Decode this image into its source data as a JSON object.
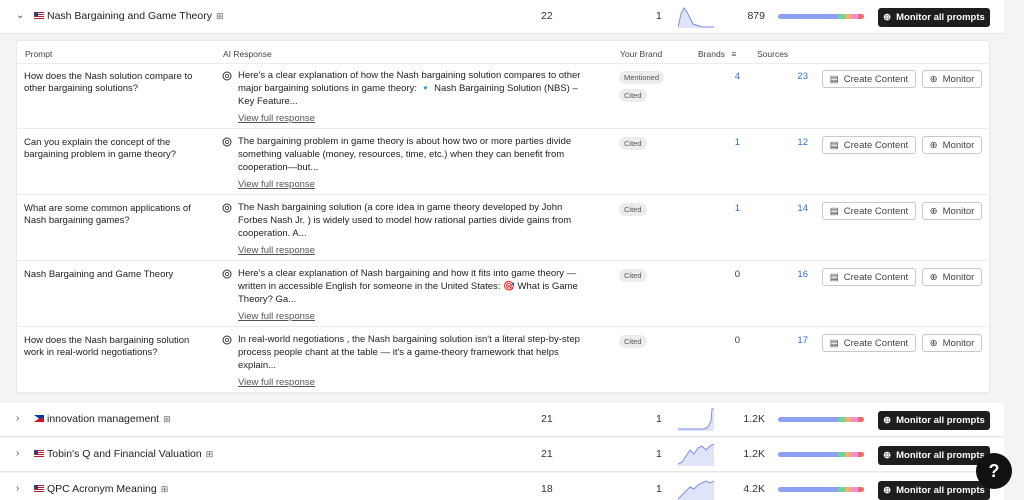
{
  "expanded_topic": {
    "name": "Nash Bargaining and Game Theory",
    "prompts_count": "22",
    "mentions": "1",
    "visibility": "879",
    "monitor_label": "Monitor all prompts"
  },
  "table": {
    "headers": {
      "prompt": "Prompt",
      "ai_response": "AI Response",
      "your_brand": "Your Brand",
      "brands": "Brands",
      "sources": "Sources"
    },
    "rows": [
      {
        "prompt": "How does the Nash solution compare to other bargaining solutions?",
        "response": "Here's a clear explanation of how the Nash bargaining solution compares to other major bargaining solutions in game theory: 🔹 Nash Bargaining Solution (NBS) – Key Feature...",
        "badges": [
          "Mentioned",
          "Cited"
        ],
        "brands": "4",
        "sources": "23"
      },
      {
        "prompt": "Can you explain the concept of the bargaining problem in game theory?",
        "response": "The bargaining problem in game theory is about how two or more parties divide something valuable (money, resources, time, etc.) when they can benefit from cooperation—but...",
        "badges": [
          "Cited"
        ],
        "brands": "1",
        "sources": "12"
      },
      {
        "prompt": "What are some common applications of Nash bargaining games?",
        "response": "The Nash bargaining solution (a core idea in game theory developed by John Forbes Nash Jr. ) is widely used to model how rational parties divide gains from cooperation. A...",
        "badges": [
          "Cited"
        ],
        "brands": "1",
        "sources": "14"
      },
      {
        "prompt": "Nash Bargaining and Game Theory",
        "response": "Here's a clear explanation of Nash bargaining and how it fits into game theory — written in accessible English for someone in the United States: 🎯 What is Game Theory? Ga...",
        "badges": [
          "Cited"
        ],
        "brands": "0",
        "sources": "16"
      },
      {
        "prompt": "How does the Nash bargaining solution work in real-world negotiations?",
        "response": "In real-world negotiations , the Nash bargaining solution isn't a literal step-by-step process people chant at the table — it's a game-theory framework that helps explain...",
        "badges": [
          "Cited"
        ],
        "brands": "0",
        "sources": "17"
      }
    ],
    "view_full_label": "View full response",
    "create_content_label": "Create Content",
    "monitor_label": "Monitor"
  },
  "collapsed_topics": [
    {
      "name": "innovation management",
      "prompts_count": "21",
      "mentions": "1",
      "visibility": "1.2K",
      "monitor_label": "Monitor all prompts",
      "flag": "ph"
    },
    {
      "name": "Tobin's Q and Financial Valuation",
      "prompts_count": "21",
      "mentions": "1",
      "visibility": "1.2K",
      "monitor_label": "Monitor all prompts",
      "flag": "us"
    },
    {
      "name": "QPC Acronym Meaning",
      "prompts_count": "18",
      "mentions": "1",
      "visibility": "4.2K",
      "monitor_label": "Monitor all prompts",
      "flag": "us"
    }
  ],
  "help": {
    "label": "?"
  },
  "colors": {
    "link_blue": "#2f6fd6",
    "dark_button": "#1e1e1e",
    "bar_blue": "#8ea0f2",
    "bar_green": "#6fd39a",
    "bar_orange": "#f4b271",
    "bar_pink": "#f08fd0",
    "bar_red": "#ee6b6b"
  }
}
